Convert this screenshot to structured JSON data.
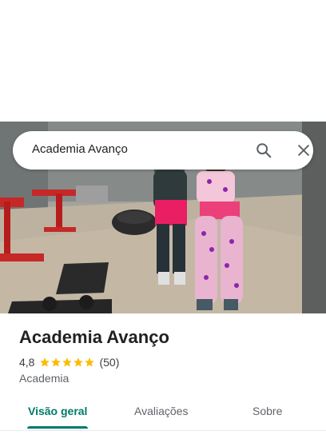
{
  "search": {
    "query": "Academia Avanço",
    "search_icon": "search-icon",
    "close_icon": "close-icon"
  },
  "place": {
    "name": "Academia Avanço",
    "rating": "4,8",
    "stars": 5,
    "star_color": "#fbbc04",
    "reviews": "(50)",
    "category": "Academia"
  },
  "tabs": [
    {
      "label": "Visão geral",
      "active": true
    },
    {
      "label": "Avaliações",
      "active": false
    },
    {
      "label": "Sobre",
      "active": false
    }
  ],
  "colors": {
    "accent": "#00796b",
    "text": "#202124",
    "secondary": "#5f6368"
  }
}
